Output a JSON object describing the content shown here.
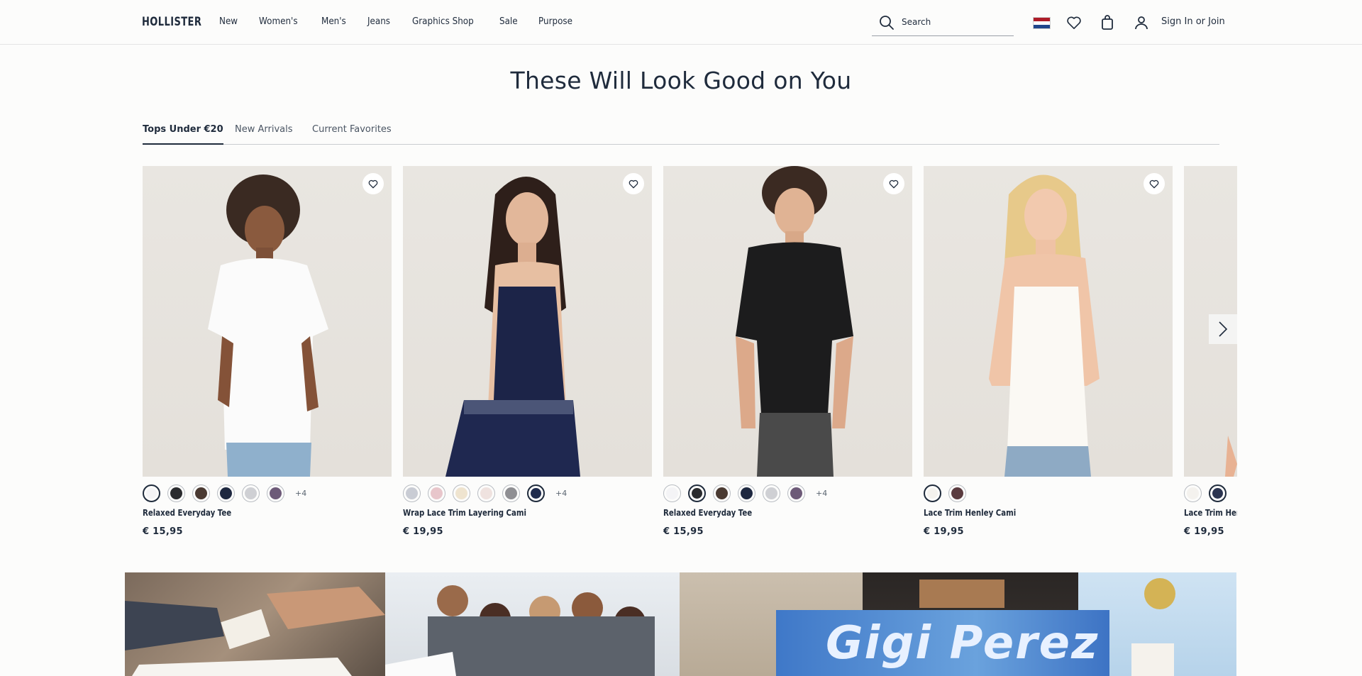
{
  "header": {
    "logo": "HOLLISTER",
    "nav": [
      "New",
      "Women's",
      "Men's",
      "Jeans",
      "Graphics Shop",
      "Sale",
      "Purpose"
    ],
    "search_placeholder": "Search",
    "signin_label": "Sign In or Join",
    "icons": [
      "search-icon",
      "flag-netherlands-icon",
      "heart-icon",
      "bag-icon",
      "user-icon"
    ]
  },
  "section": {
    "title": "These Will Look Good on You",
    "tabs": [
      "Tops Under €20",
      "New Arrivals",
      "Current Favorites"
    ],
    "active_tab": "Tops Under €20"
  },
  "products": [
    {
      "name": "Relaxed Everyday Tee",
      "price": "€ 15,95",
      "more": "+4",
      "swatches": [
        "#f4f4f6",
        "#2a2b2e",
        "#4a3a32",
        "#1e2840",
        "#cfd0d4",
        "#6d5a78"
      ]
    },
    {
      "name": "Wrap Lace Trim Layering Cami",
      "price": "€ 19,95",
      "more": "+4",
      "swatches": [
        "#c9ccd4",
        "#e8c6cb",
        "#efe4cf",
        "#efe2df",
        "#8f8f93",
        "#1f2b4d"
      ]
    },
    {
      "name": "Relaxed Everyday Tee",
      "price": "€ 15,95",
      "more": "+4",
      "swatches": [
        "#f4f4f6",
        "#2a2b2e",
        "#4a3a32",
        "#1e2840",
        "#cfd0d4",
        "#6d5a78"
      ]
    },
    {
      "name": "Lace Trim Henley Cami",
      "price": "€ 19,95",
      "more": "",
      "swatches": [
        "#f4f2ee",
        "#5a3b3f"
      ]
    },
    {
      "name": "Lace Trim Henley Cami",
      "price": "€ 19,95",
      "more": "",
      "swatches": [
        "#f4f2ee",
        "#2b3450"
      ]
    }
  ],
  "collage": {
    "banner_text": "Gigi Perez"
  },
  "colors": {
    "navy": "#1f2b3c",
    "background": "#fcfcfb"
  }
}
